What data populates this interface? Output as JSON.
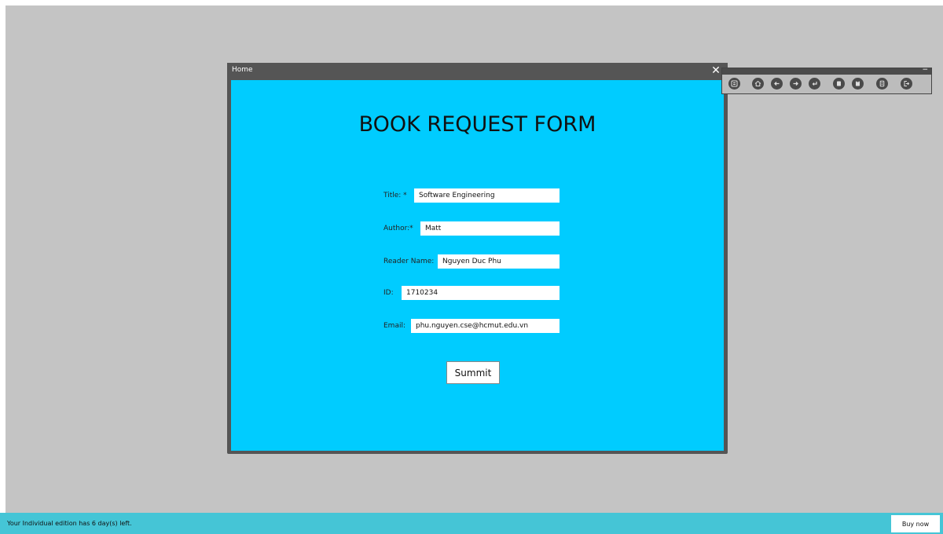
{
  "window": {
    "title": "Home",
    "close_symbol": "✕"
  },
  "form": {
    "heading": "BOOK REQUEST FORM",
    "fields": [
      {
        "label": "Title: *",
        "value": "Software Engineering"
      },
      {
        "label": "Author:*",
        "value": "Matt"
      },
      {
        "label": "Reader Name:",
        "value": "Nguyen Duc Phu"
      },
      {
        "label": "ID:",
        "value": "1710234"
      },
      {
        "label": "Email:",
        "value": "phu.nguyen.cse@hcmut.edu.vn"
      }
    ],
    "submit_label": "Summit"
  },
  "toolbar": {
    "minimize_symbol": "−",
    "icons": [
      "menu-icon",
      "home-icon",
      "back-icon",
      "forward-icon",
      "return-icon",
      "copy-icon",
      "paste-icon",
      "document-icon",
      "exit-icon"
    ]
  },
  "statusbar": {
    "message": "Your Individual edition has 6 day(s) left.",
    "buy_label": "Buy now"
  },
  "colors": {
    "form_background": "#00ccff",
    "window_frame": "#555555",
    "desktop": "#c4c4c4",
    "statusbar": "#45c5d6"
  }
}
